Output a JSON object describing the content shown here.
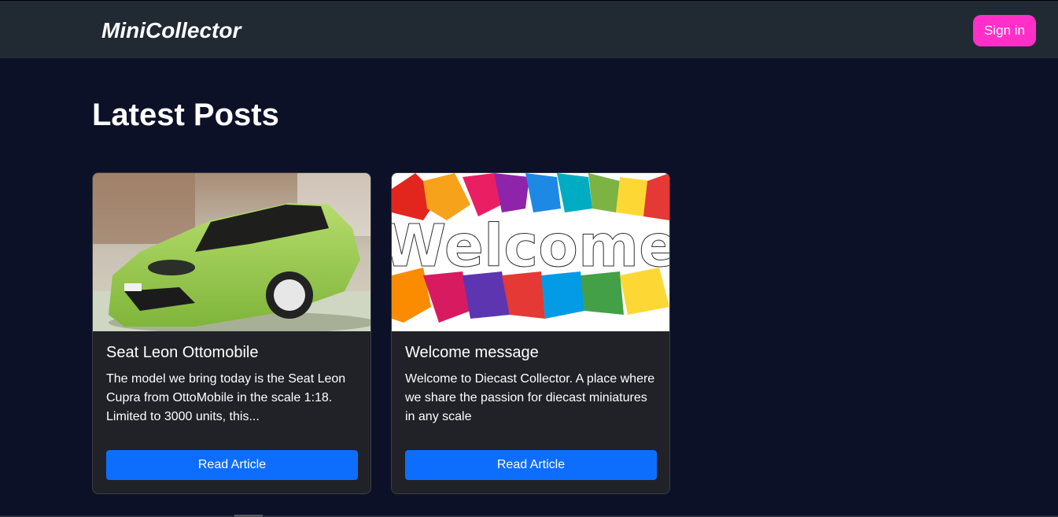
{
  "nav": {
    "brand": "MiniCollector",
    "signin_label": "Sign in"
  },
  "main": {
    "heading": "Latest Posts",
    "posts": [
      {
        "image": "green-seat-leon-model-car-photo",
        "title": "Seat Leon Ottomobile",
        "excerpt": "The model we bring today is the Seat Leon Cupra from OttoMobile in the scale 1:18. Limited to 3000 units, this...",
        "button_label": "Read Article"
      },
      {
        "image": "welcome-colorful-leaves-banner",
        "image_text": "Welcome",
        "title": "Welcome message",
        "excerpt": "Welcome to Diecast Collector. A place where we share the passion for diecast miniatures in any scale",
        "button_label": "Read Article"
      }
    ]
  },
  "colors": {
    "background": "#0c1127",
    "navbar": "#212933",
    "signin": "#ff2fc8",
    "card": "#202227",
    "primary_button": "#0d6efd"
  }
}
